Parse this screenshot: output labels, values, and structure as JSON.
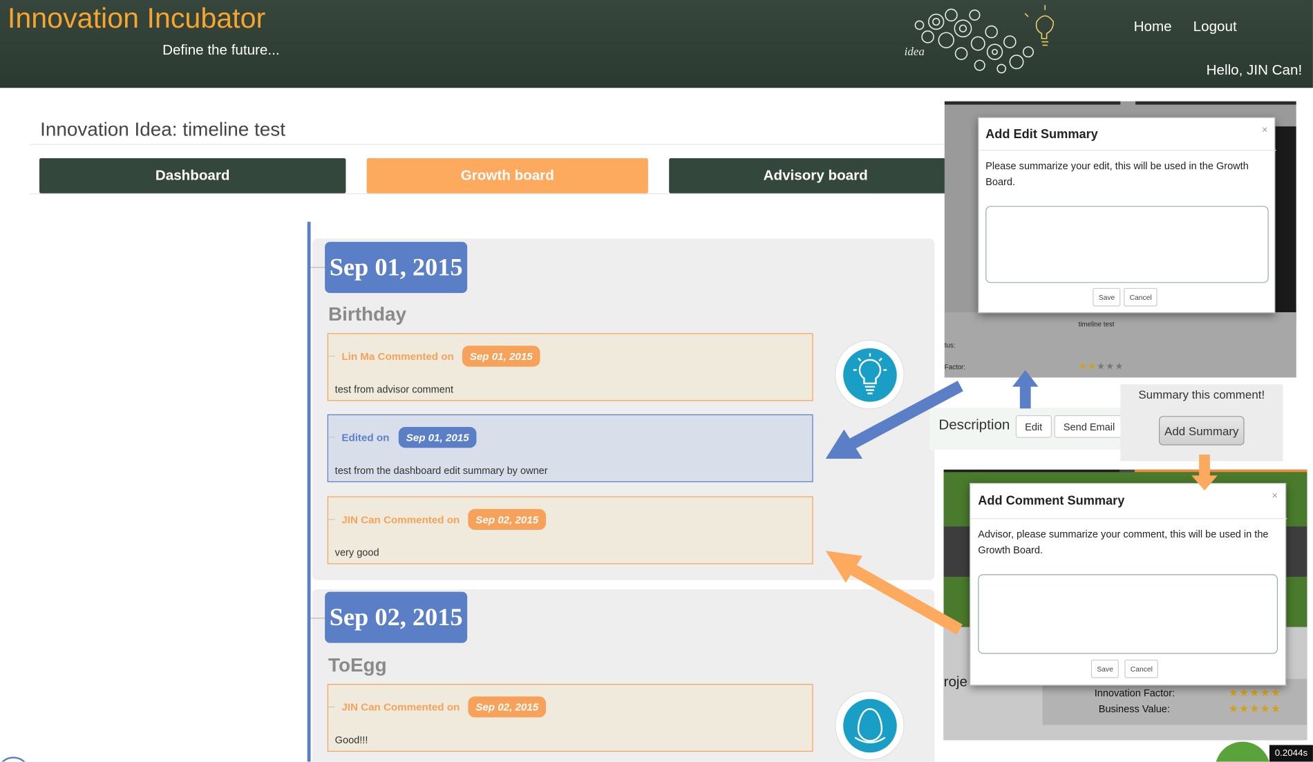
{
  "header": {
    "brand": "Innovation Incubator",
    "tagline": "Define the future...",
    "logo_text": "idea",
    "nav": {
      "home": "Home",
      "logout": "Logout"
    },
    "greeting": "Hello, JIN Can!"
  },
  "page": {
    "title": "Innovation Idea: timeline test",
    "tabs": [
      {
        "label": "Dashboard",
        "color": "#33473c"
      },
      {
        "label": "Growth board",
        "color": "#fda95e"
      },
      {
        "label": "Advisory board",
        "color": "#33473c"
      }
    ]
  },
  "timeline": [
    {
      "date": "Sep 01, 2015",
      "stage": "Birthday",
      "icon": "lightbulb-icon",
      "entries": [
        {
          "type": "comment",
          "label": "Lin Ma Commented on",
          "date": "Sep 01, 2015",
          "text": "test from advisor comment"
        },
        {
          "type": "edit",
          "label": "Edited on",
          "date": "Sep 01, 2015",
          "text": "test from the dashboard edit summary by owner"
        },
        {
          "type": "comment",
          "label": "JIN Can Commented on",
          "date": "Sep 02, 2015",
          "text": "very good"
        }
      ]
    },
    {
      "date": "Sep 02, 2015",
      "stage": "ToEgg",
      "icon": "egg-icon",
      "entries": [
        {
          "type": "comment",
          "label": "JIN Can Commented on",
          "date": "Sep 02, 2015",
          "text": "Good!!!"
        }
      ]
    }
  ],
  "edit_modal": {
    "title": "Add Edit Summary",
    "close": "×",
    "text": "Please summarize your edit, this will be used in the Growth Board.",
    "save": "Save",
    "cancel": "Cancel",
    "bg_text": "timeline test",
    "bg_status": "tus:",
    "bg_factor": "Factor:"
  },
  "description_bar": {
    "label": "Description",
    "edit": "Edit",
    "send_email": "Send Email"
  },
  "summary_prompt": {
    "text": "Summary this comment!",
    "button": "Add Summary"
  },
  "comment_modal": {
    "title": "Add Comment Summary",
    "close": "×",
    "text": "Advisor, please summarize your comment, this will be used in the Growth Board.",
    "save": "Save",
    "cancel": "Cancel",
    "bg_project": "roje",
    "bg_innovation": "Innovation Factor:",
    "bg_business": "Business Value:"
  },
  "timer": "0.2044s",
  "colors": {
    "header": "#2f3f35",
    "brand": "#f7a52c",
    "timeline_blue": "#5b7fc7",
    "comment_orange": "#f7a25a",
    "icon_teal": "#199ec6"
  }
}
